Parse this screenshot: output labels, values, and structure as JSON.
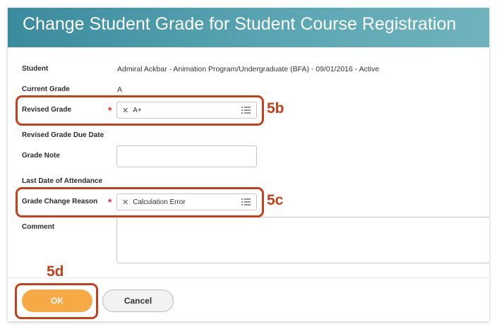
{
  "header": {
    "title": "Change Student Grade for Student Course Registration"
  },
  "form": {
    "student": {
      "label": "Student",
      "value": "Admiral  Ackbar  - Animation Program/Undergraduate (BFA) - 09/01/2016 - Active"
    },
    "current_grade": {
      "label": "Current Grade",
      "value": "A"
    },
    "revised_grade": {
      "label": "Revised Grade",
      "required_mark": "*",
      "selected": "A+"
    },
    "revised_grade_due_date": {
      "label": "Revised Grade Due Date"
    },
    "grade_note": {
      "label": "Grade Note",
      "value": ""
    },
    "last_date_of_attendance": {
      "label": "Last Date of Attendance"
    },
    "grade_change_reason": {
      "label": "Grade Change Reason",
      "required_mark": "*",
      "selected": "Calculation Error"
    },
    "comment": {
      "label": "Comment",
      "value": ""
    }
  },
  "buttons": {
    "ok": "OK",
    "cancel": "Cancel"
  },
  "callouts": {
    "revised": "5b",
    "reason": "5c",
    "ok": "5d"
  },
  "icons": {
    "remove": "close-x-icon",
    "prompt": "list-icon"
  },
  "colors": {
    "header": "#3a8b9e",
    "ok_button": "#f6a945",
    "callout": "#c7401c",
    "required": "#d9342b"
  }
}
